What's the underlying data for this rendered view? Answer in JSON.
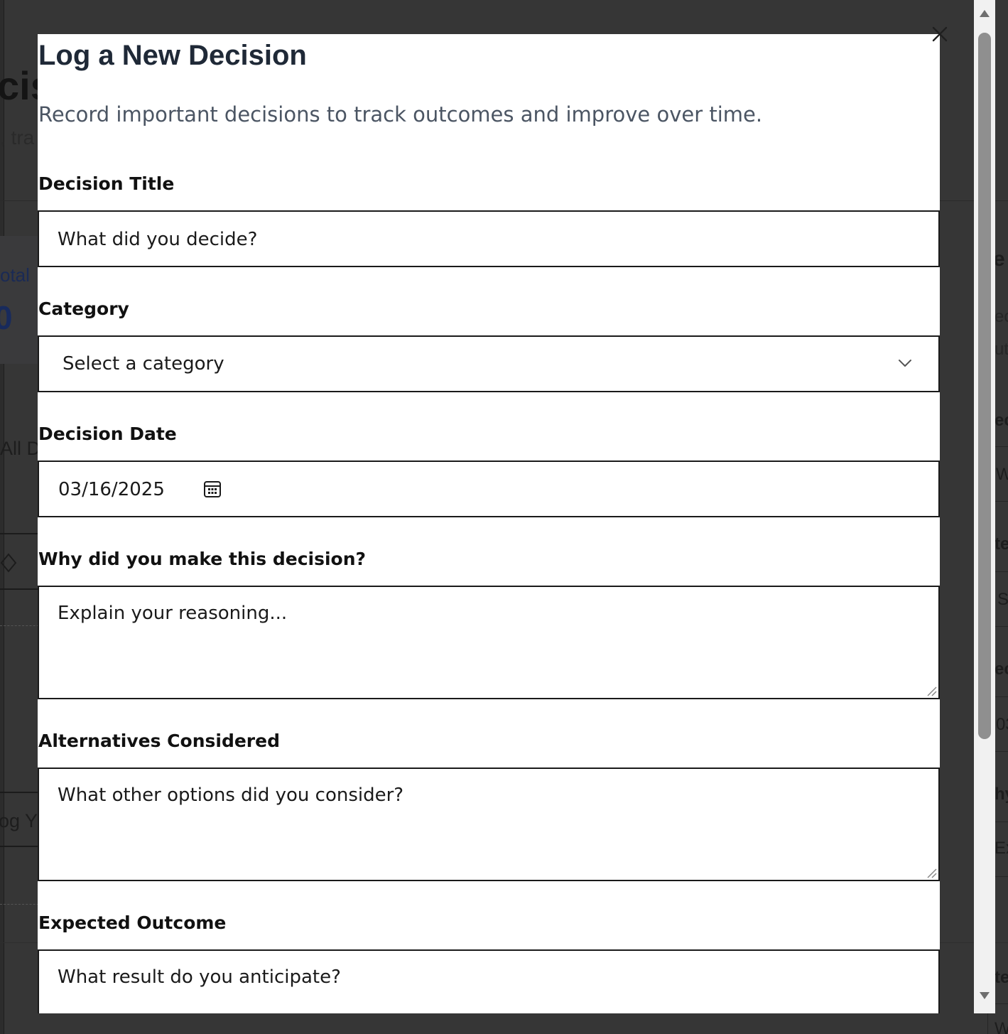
{
  "modal": {
    "title": "Log a New Decision",
    "description": "Record important decisions to track outcomes and improve over time.",
    "close_icon": "close-icon"
  },
  "form": {
    "decision_title": {
      "label": "Decision Title",
      "placeholder": "What did you decide?"
    },
    "category": {
      "label": "Category",
      "selected": "Select a category"
    },
    "decision_date": {
      "label": "Decision Date",
      "value": "03/16/2025"
    },
    "reasoning": {
      "label": "Why did you make this decision?",
      "placeholder": "Explain your reasoning..."
    },
    "alternatives": {
      "label": "Alternatives Considered",
      "placeholder": "What other options did you consider?"
    },
    "expected_outcome": {
      "label": "Expected Outcome",
      "placeholder": "What result do you anticipate?"
    }
  },
  "background": {
    "heading_fragment": "cis",
    "subtitle_fragment": ", tra",
    "stat_label_fragment": "otal",
    "stat_value_fragment": "0",
    "tab_fragment": "All D",
    "button_fragment": "og Y",
    "right_fragments": [
      "e",
      "ec",
      "ut",
      "ec",
      "W",
      "te",
      "S",
      "ec",
      "03",
      "hy",
      "Ex",
      "te",
      "W"
    ]
  },
  "colors": {
    "overlay": "#363636",
    "modal_bg": "#ffffff",
    "title": "#1f2937",
    "description": "#4b5563",
    "border": "#1a1a1a"
  }
}
